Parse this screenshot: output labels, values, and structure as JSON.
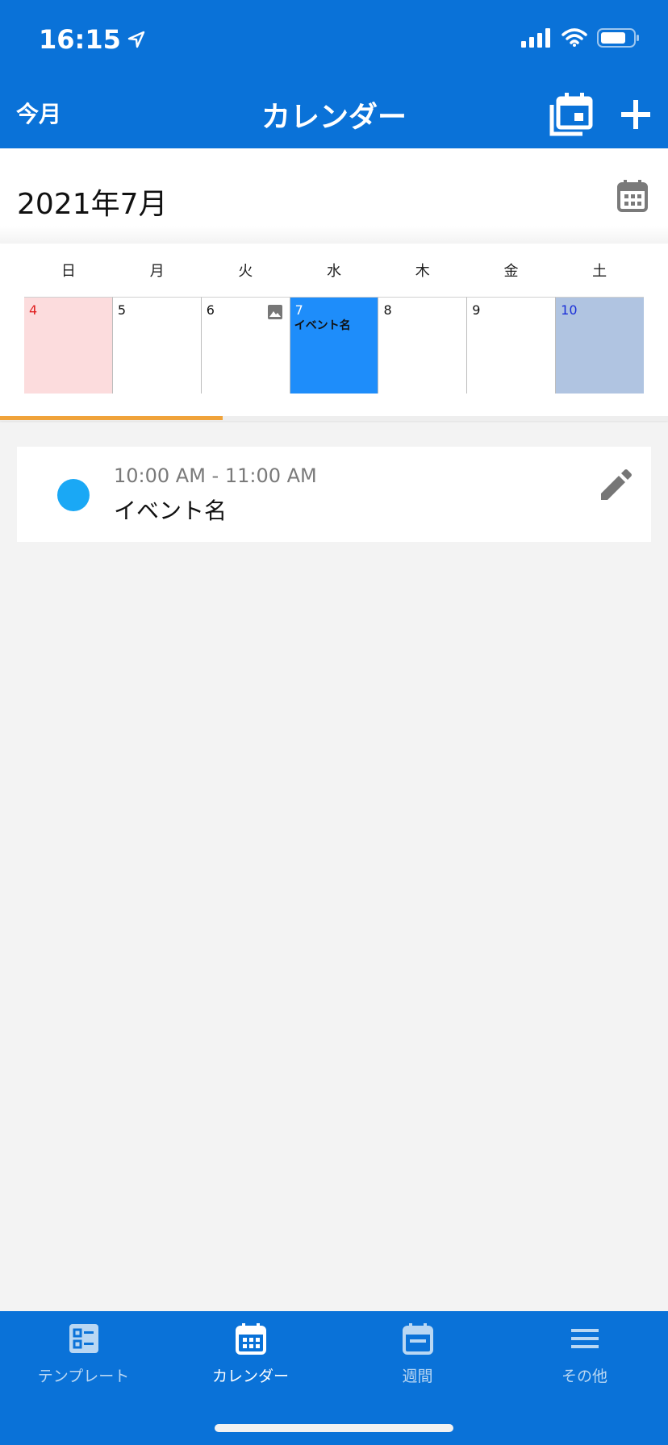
{
  "status_bar": {
    "time": "16:15"
  },
  "nav": {
    "left_label": "今月",
    "title": "カレンダー"
  },
  "month": {
    "label": "2021年7月"
  },
  "week": {
    "weekdays": [
      "日",
      "月",
      "火",
      "水",
      "木",
      "金",
      "土"
    ],
    "days": [
      {
        "num": "4",
        "event": ""
      },
      {
        "num": "5",
        "event": ""
      },
      {
        "num": "6",
        "event": ""
      },
      {
        "num": "7",
        "event": "イベント名"
      },
      {
        "num": "8",
        "event": ""
      },
      {
        "num": "9",
        "event": ""
      },
      {
        "num": "10",
        "event": ""
      }
    ],
    "selected_index": 3,
    "progress_fraction": 0.333
  },
  "events": [
    {
      "time": "10:00 AM - 11:00 AM",
      "name": "イベント名",
      "color": "#1aa8f5"
    }
  ],
  "tabbar": {
    "tabs": [
      {
        "label": "テンプレート",
        "icon": "template-icon"
      },
      {
        "label": "カレンダー",
        "icon": "calendar-icon"
      },
      {
        "label": "週間",
        "icon": "week-icon"
      },
      {
        "label": "その他",
        "icon": "menu-icon"
      }
    ],
    "active_index": 1
  },
  "colors": {
    "brand": "#0a72d8",
    "selected_day": "#1e8dfa",
    "sunday_bg": "#fcdcdd",
    "saturday_bg": "#b0c4e1",
    "progress": "#f0a33a"
  }
}
